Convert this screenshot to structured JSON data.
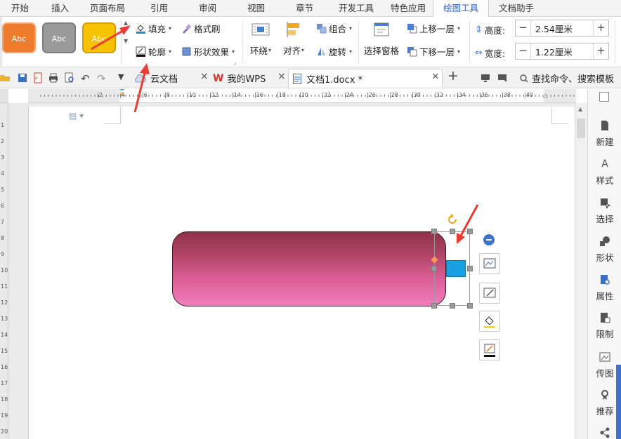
{
  "menu": {
    "tabs": [
      "开始",
      "插入",
      "页面布局",
      "引用",
      "审阅",
      "视图",
      "章节",
      "开发工具",
      "特色应用",
      "绘图工具",
      "文档助手"
    ],
    "active_tab": "绘图工具"
  },
  "ribbon": {
    "style_samples": [
      "Abc",
      "Abc",
      "Abc"
    ],
    "fill": "填充",
    "outline": "轮廓",
    "format_painter": "格式刷",
    "shape_effects": "形状效果",
    "wrap": "环绕",
    "align": "对齐",
    "group": "组合",
    "rotate": "旋转",
    "selection_pane": "选择窗格",
    "bring_forward": "上移一层",
    "send_backward": "下移一层",
    "height_label": "高度:",
    "height_value": "2.54厘米",
    "width_label": "宽度:",
    "width_value": "1.22厘米"
  },
  "tabs_row": {
    "cloud_docs": "云文档",
    "my_wps": "我的WPS",
    "document": "文档1.docx *",
    "search_commands": "查找命令、搜索模板"
  },
  "ruler": {
    "horizontal": [
      "|2",
      "|4",
      "|6",
      "|8",
      "|10",
      "|12",
      "|14",
      "|16",
      "|18",
      "|20",
      "|22",
      "|24",
      "|26",
      "|28",
      "|30",
      "|32",
      "|34",
      "|36",
      "|38",
      "|40"
    ],
    "vertical": [
      "1",
      "2",
      "3",
      "4",
      "5",
      "6",
      "7",
      "8",
      "9",
      "10",
      "11",
      "12",
      "13",
      "14",
      "15",
      "16",
      "17",
      "18",
      "19",
      "20"
    ]
  },
  "sidebar": {
    "items": [
      "新建",
      "样式",
      "选择",
      "形状",
      "属性",
      "限制",
      "传图",
      "推荐"
    ]
  },
  "colors": {
    "accent": "#2a62c4",
    "arrow": "#e83c35",
    "shape_top": "#8e3247",
    "shape_bottom": "#f07ebd",
    "blue_square": "#1a9fe3",
    "style_orange": "#ef7b2d",
    "style_grey": "#9a9a9a",
    "style_yellow": "#f7c200"
  }
}
